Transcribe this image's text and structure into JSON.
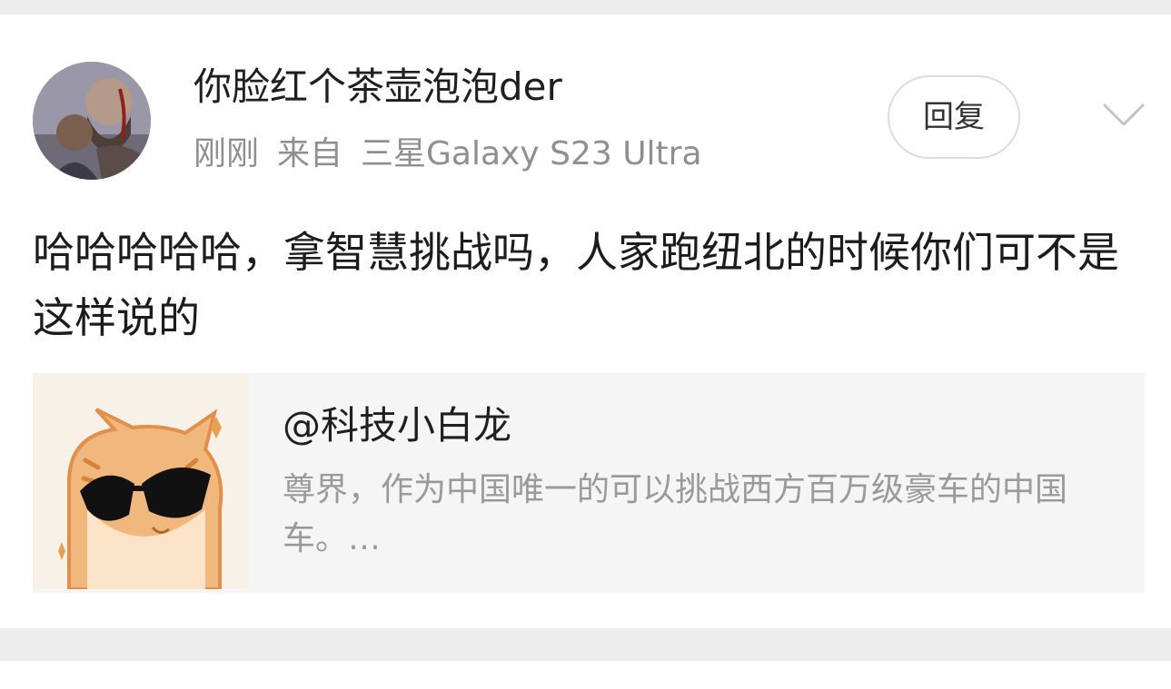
{
  "comment": {
    "username": "你脸红个茶壶泡泡der",
    "time": "刚刚",
    "source_prefix": "来自",
    "device": "三星Galaxy S23 Ultra",
    "reply_label": "回复",
    "text": "哈哈哈哈哈，拿智慧挑战吗，人家跑纽北的时候你们可不是这样说的",
    "avatar_icon": "god-of-war-avatar",
    "expand_icon": "chevron-down-icon"
  },
  "quoted_post": {
    "author": "@科技小白龙",
    "text": "尊界，作为中国唯一的可以挑战西方百万级豪车的中国车。…",
    "thumbnail_icon": "sunglasses-cat-avatar"
  },
  "colors": {
    "username": "#1f1f1f",
    "meta": "#8f8f8f",
    "quote_background": "#f5f5f5",
    "quote_text": "#9a9a9a",
    "page_background": "#ededed"
  }
}
